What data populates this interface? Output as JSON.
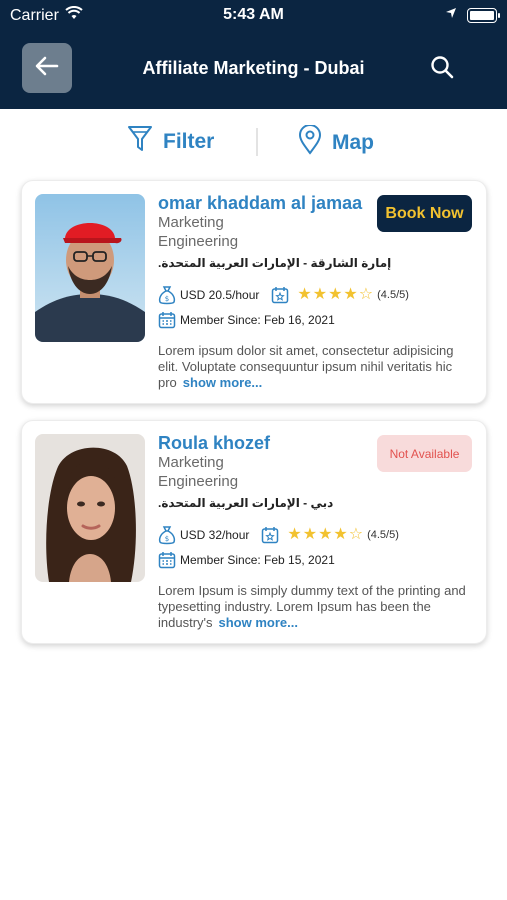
{
  "status_bar": {
    "carrier": "Carrier",
    "time": "5:43 AM"
  },
  "header": {
    "title": "Affiliate Marketing - Dubai"
  },
  "toolbar": {
    "filter_label": "Filter",
    "map_label": "Map"
  },
  "profiles": [
    {
      "name": "omar khaddam al jamaa",
      "role_line1": "Marketing",
      "role_line2": "Engineering",
      "location": "إمارة الشارقة - الإمارات العربية المتحدة.",
      "rate": "USD 20.5/hour",
      "rating": 4.5,
      "rating_text": "(4.5/5)",
      "member_since": "Member Since: Feb 16, 2021",
      "description": "Lorem ipsum dolor sit amet, consectetur adipisicing elit. Voluptate consequuntur ipsum nihil veritatis hic pro",
      "more_label": "show more...",
      "action_label": "Book Now"
    },
    {
      "name": "Roula khozef",
      "role_line1": "Marketing",
      "role_line2": "Engineering",
      "location": "دبي - الإمارات العربية المتحدة.",
      "rate": "USD 32/hour",
      "rating": 4.5,
      "rating_text": "(4.5/5)",
      "member_since": "Member Since: Feb 15, 2021",
      "description": "Lorem Ipsum is simply dummy text of the printing and typesetting industry. Lorem Ipsum has been the industry's",
      "more_label": "show more...",
      "action_label": "Not Available"
    }
  ],
  "colors": {
    "navy": "#0b2541",
    "accent_blue": "#2f83c2",
    "star_yellow": "#f2c230",
    "unavailable_bg": "#f8dbdb",
    "unavailable_text": "#e2524f"
  }
}
